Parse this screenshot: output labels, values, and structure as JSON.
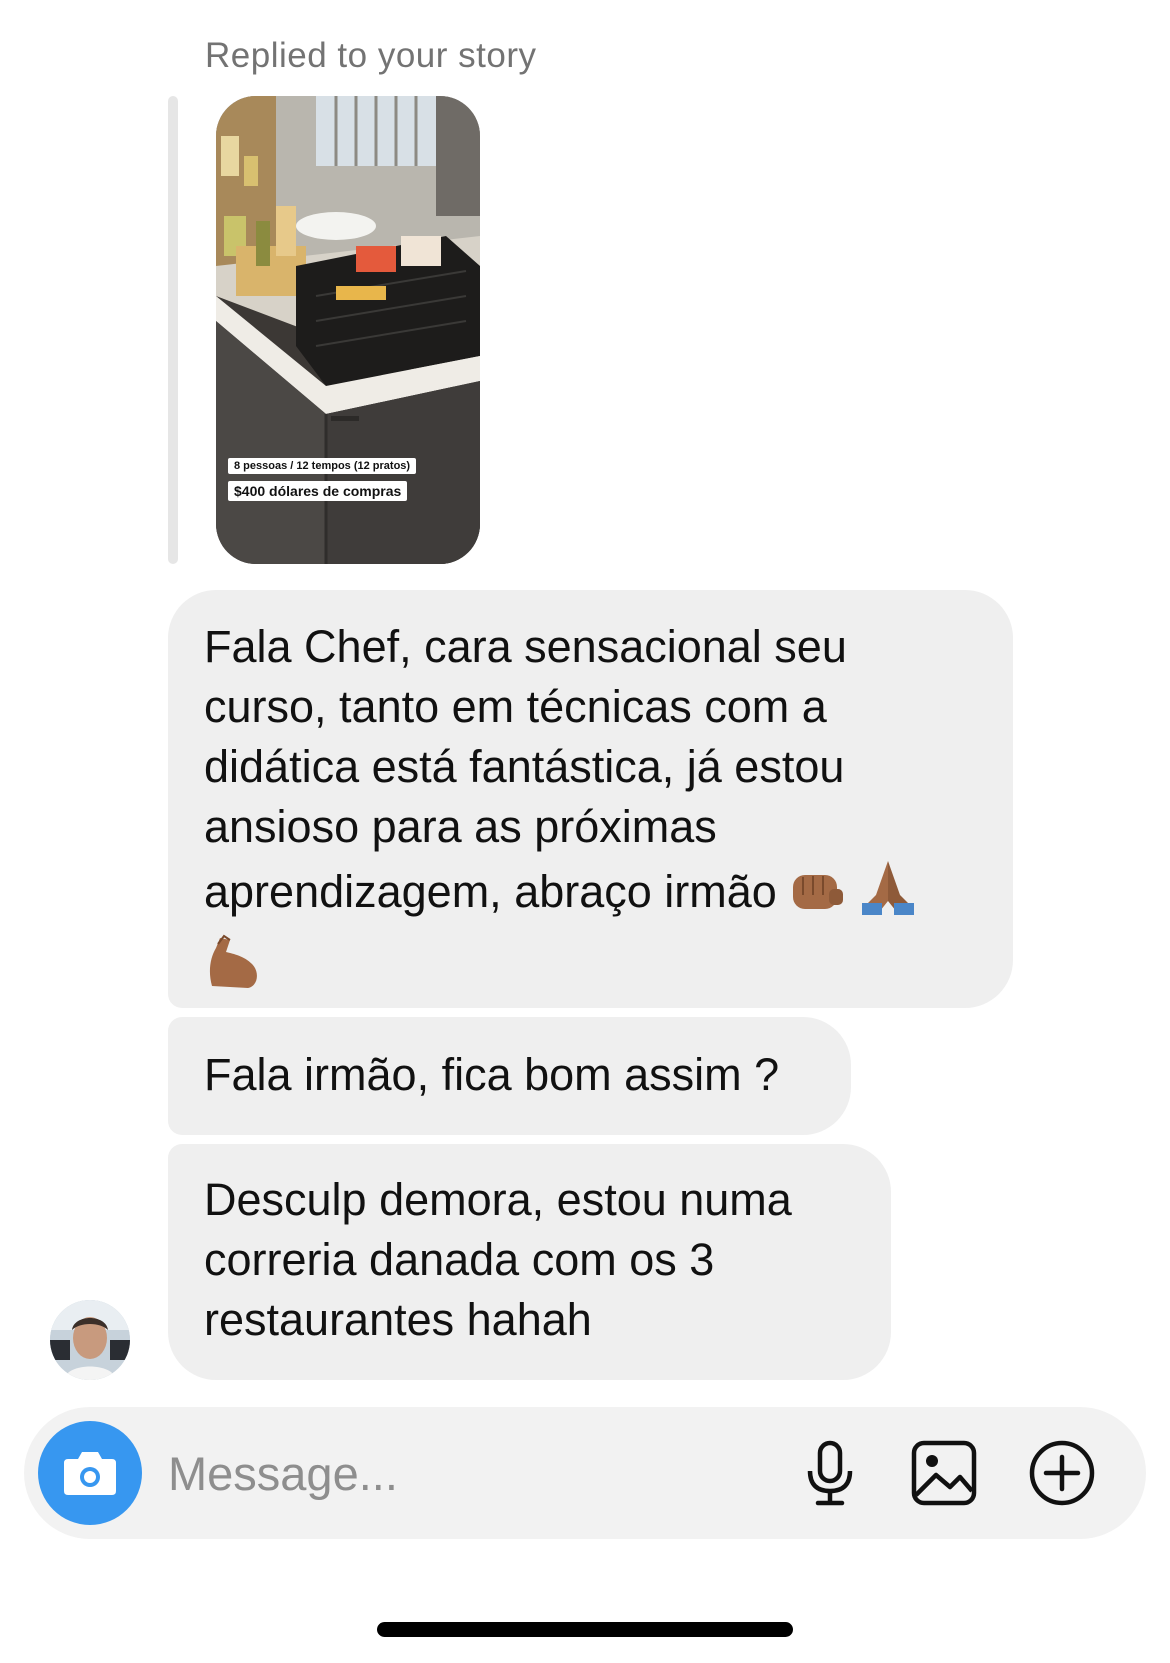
{
  "reply": {
    "caption": "Replied to your story",
    "story_labels": [
      "8 pessoas / 12 tempos (12 pratos)",
      "$400 dólares de compras"
    ]
  },
  "messages": [
    {
      "text": "Fala Chef, cara sensacional seu curso, tanto em técnicas com a didática está fantástica, já estou ansioso para as próximas aprendizagem, abraço irmão",
      "emojis": [
        "fist-bump",
        "folded-hands",
        "flexed-biceps"
      ]
    },
    {
      "text": "Fala irmão, fica bom assim ?"
    },
    {
      "text": "Desculp demora, estou numa correria danada com os 3 restaurantes hahah"
    }
  ],
  "composer": {
    "placeholder": "Message...",
    "icons": [
      "camera-icon",
      "microphone-icon",
      "gallery-icon",
      "add-icon"
    ],
    "camera_color": "#3797f0"
  },
  "colors": {
    "bubble": "#efefef",
    "caption": "#737373",
    "composer_bg": "#f2f2f2"
  }
}
